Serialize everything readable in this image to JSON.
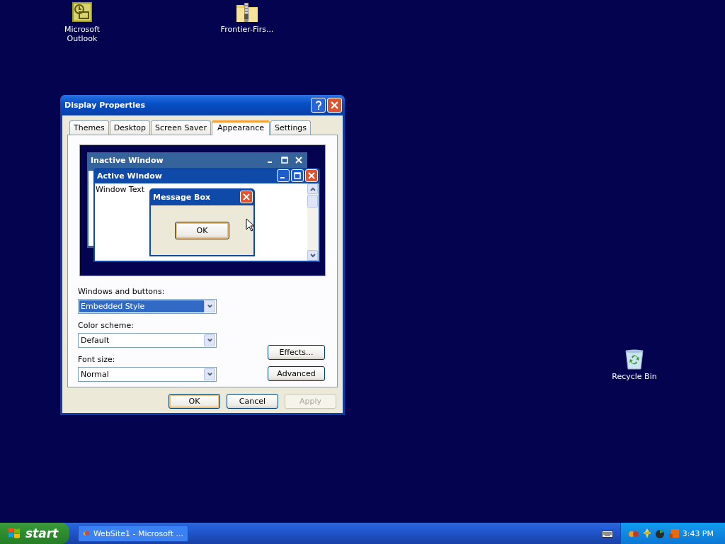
{
  "desktop_icons": [
    {
      "kind": "mail",
      "label": "Microsoft Outlook"
    },
    {
      "kind": "zip",
      "label": "Frontier-Firs..."
    },
    {
      "kind": "recycle",
      "label": "Recycle Bin"
    }
  ],
  "dialog": {
    "title": "Display Properties",
    "tabs": [
      {
        "label": "Themes",
        "selected": false
      },
      {
        "label": "Desktop",
        "selected": false
      },
      {
        "label": "Screen Saver",
        "selected": false
      },
      {
        "label": "Appearance",
        "selected": true
      },
      {
        "label": "Settings",
        "selected": false
      }
    ],
    "preview": {
      "inactive_title": "Inactive Window",
      "active_title": "Active Window",
      "window_text": "Window Text",
      "message_title": "Message Box",
      "message_button": "OK"
    },
    "fields": [
      {
        "label": "Windows and buttons:",
        "value": "Embedded Style",
        "selected": true
      },
      {
        "label": "Color scheme:",
        "value": "Default",
        "selected": false
      },
      {
        "label": "Font size:",
        "value": "Normal",
        "selected": false
      }
    ],
    "side_buttons": [
      "Effects...",
      "Advanced"
    ],
    "buttons": [
      {
        "label": "OK",
        "default": true,
        "disabled": false
      },
      {
        "label": "Cancel",
        "default": false,
        "disabled": false
      },
      {
        "label": "Apply",
        "default": false,
        "disabled": true
      }
    ]
  },
  "taskbar": {
    "start": "start",
    "tasks": [
      {
        "label": "WebSite1 - Microsoft ...",
        "selected": false
      }
    ],
    "clock": "3:43 PM"
  }
}
